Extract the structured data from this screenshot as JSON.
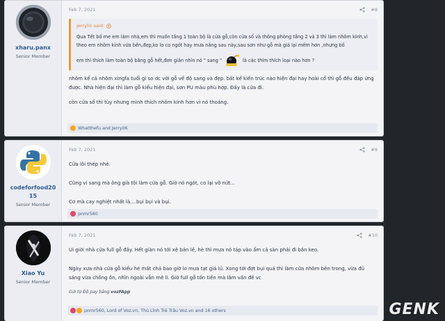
{
  "posts": [
    {
      "author": "xharu.panx",
      "title": "Senior Member",
      "date": "Feb 7, 2021",
      "num": "#8",
      "quote": {
        "author": "jerrylin said:",
        "line1": "Qua Tết bố me em làm nhà,em thì muốn tầng 1 toàn bộ là cửa gỗ,còn cửa sổ và thông phòng tầng 2 và 3 thì làm nhôm kính,vì theo em nhôm kính vừa bền,đẹp,ko lo co ngót hay mưa nắng sau này,sau sơn như gỗ mà giá lại mềm hơn ,nhưng bố",
        "line2a": "em thì thích làm toàn bộ bằng gỗ hết,đơn giản nhìn nó \" sang \"",
        "line2b": "là các thím thích loại nào hơn ?"
      },
      "paragraphs": [
        "nhôm kể cả nhôm xingfa tuổi gì so dc với gỗ về độ sang và đẹp. bất kể kiến trúc nào hiện đại hay hoài cổ thì gỗ đều đáp ứng được. Nhà hiện đại thì làm gỗ kiểu hiện đại, sơn PU màu phù hợp. Đấy là cửa đi.",
        "còn cửa sổ thì tùy nhưng mình thích nhôm kính hơn vì nó thoáng."
      ],
      "reactions": "Whatthefu and Jerry06"
    },
    {
      "author": "codeforfood2015",
      "author_line1": "codeforfood20",
      "author_line2": "15",
      "title": "Senior Member",
      "date": "Feb 7, 2021",
      "num": "#9",
      "paragraphs": [
        "Cửa lõi thép nhé.",
        "Cũng vì sang mà ông già tôi làm cửa gỗ. Giờ nó ngót, co lại vỡ nứt...",
        "Cơ mà cay nghiệt nhất là....bụi bụi và bụi."
      ],
      "reactions": "pnmr560"
    },
    {
      "author": "Xiao Yu",
      "title": "Senior Member",
      "date": "Feb 7, 2021",
      "num": "#10",
      "paragraphs": [
        "Ui giời nhà cửa full gỗ đây. Hết giàn nó tới xệ bản lề, hè thì mưa nó táp vào ẩm cả sàn phải đi bắn keo.",
        "Ngày xưa nhà cửa gỗ kiểu hé mất chả bao giờ lo mưa tạt giá lủ. Xong tới đợt bụi quá thì làm cửa nhôm bên trong, vừa đủ sáng vừa chống ồn, nhìn ngoài vẫn mê li. Giờ full gỗ tốn tiền mà lắm vấn đề vc"
      ],
      "signature_prefix": "Gửi từ Đồ pay bằng ",
      "signature_app": "vozFApp",
      "reactions": "pnmr560, Lord of Voz.vn, Thủ Lĩnh Trẻ Trâu Voz.vn and 16 others"
    }
  ],
  "watermark": "GENK",
  "colors": {
    "accent": "#e3873a",
    "link": "#2f5b8f",
    "bg": "#22262b"
  }
}
